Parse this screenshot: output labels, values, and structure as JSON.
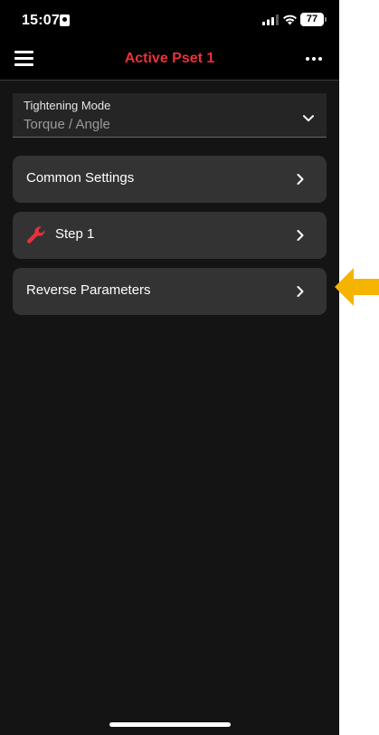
{
  "status_bar": {
    "time": "15:07",
    "battery": "77"
  },
  "nav": {
    "title": "Active Pset 1",
    "title_color": "#e8323c"
  },
  "tightening_mode": {
    "label": "Tightening Mode",
    "value": "Torque / Angle"
  },
  "rows": [
    {
      "label": "Common Settings",
      "icon": null
    },
    {
      "label": "Step 1",
      "icon": "wrench-icon"
    },
    {
      "label": "Reverse Parameters",
      "icon": null
    }
  ],
  "annotation": {
    "icon": "arrow-left-icon",
    "color": "#f5b400"
  }
}
